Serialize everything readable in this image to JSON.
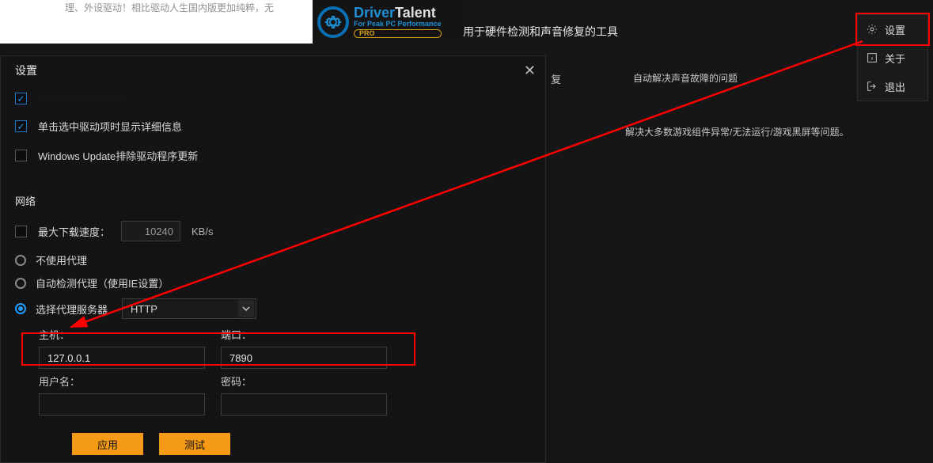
{
  "header": {
    "snippet": "理、外设驱动！相比驱动人生国内版更加纯粹，无",
    "logo": {
      "driver": "Driver",
      "talent": "Talent",
      "slogan": "For Peak PC Performance",
      "pro": "PRO"
    },
    "subtitle": "用于硬件检测和声音修复的工具",
    "sound_tip": "自动解决声音故障的问题",
    "game_tip": "解决大多数游戏组件异常/无法运行/游戏黑屏等问题。",
    "partial": "复"
  },
  "menu": {
    "settings": "设置",
    "about": "关于",
    "exit": "退出"
  },
  "modal": {
    "title": "设置",
    "chk_truncated": "*********************",
    "chk_detailed": "单击选中驱动项时显示详细信息",
    "chk_wu": "Windows Update排除驱动程序更新",
    "section_net": "网络",
    "speed_label": "最大下载速度：",
    "speed_value": "10240",
    "speed_unit": "KB/s",
    "proxy_none": "不使用代理",
    "proxy_auto": "自动检测代理（使用IE设置）",
    "proxy_choose": "选择代理服务器",
    "proto_value": "HTTP",
    "host_label": "主机：",
    "port_label": "端口：",
    "host_value": "127.0.0.1",
    "port_value": "7890",
    "user_label": "用户名：",
    "pass_label": "密码：",
    "btn_apply": "应用",
    "btn_test": "测试"
  }
}
